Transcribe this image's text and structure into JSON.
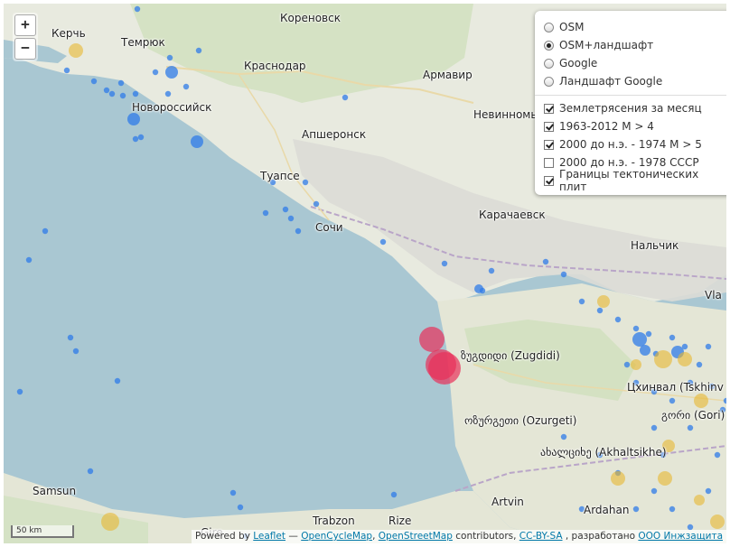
{
  "map": {
    "cities": [
      {
        "name": "Керчь"
      },
      {
        "name": "Темрюк"
      },
      {
        "name": "Кореновск"
      },
      {
        "name": "Краснодар"
      },
      {
        "name": "Армавир"
      },
      {
        "name": "Новороссийск"
      },
      {
        "name": "Невинномы"
      },
      {
        "name": "Апшеронск"
      },
      {
        "name": "Туапсе"
      },
      {
        "name": "Сочи"
      },
      {
        "name": "Карачаевск"
      },
      {
        "name": "Нальчик"
      },
      {
        "name": "Vla"
      },
      {
        "name": "ზუგდიდი (Zugdidi)"
      },
      {
        "name": "Цхинвал (Tskhinv"
      },
      {
        "name": "გორი (Gori)"
      },
      {
        "name": "ოზურგეთი (Ozurgeti)"
      },
      {
        "name": "ახალციხე (Akhaltsikhe)"
      },
      {
        "name": "Samsun"
      },
      {
        "name": "Artvin"
      },
      {
        "name": "Ardahan"
      },
      {
        "name": "Trabzon"
      },
      {
        "name": "Rize"
      },
      {
        "name": "Gire"
      }
    ],
    "colors": {
      "sea": "#a9c7d2",
      "land": "#e6e8dc",
      "recent_quake": "#e8315a",
      "quake_1963": "#2f7be8",
      "quake_historic": "#e8b830"
    }
  },
  "controls": {
    "zoom_in": "+",
    "zoom_out": "−"
  },
  "layers": {
    "base": [
      {
        "label": "OSM",
        "selected": false
      },
      {
        "label": "OSM+ландшафт",
        "selected": true
      },
      {
        "label": "Google",
        "selected": false
      },
      {
        "label": "Ландшафт Google",
        "selected": false
      }
    ],
    "overlays": [
      {
        "label": "Землетрясения за месяц",
        "checked": true
      },
      {
        "label": "1963-2012 M > 4",
        "checked": true
      },
      {
        "label": "2000 до н.э. - 1974 M > 5",
        "checked": true
      },
      {
        "label": "2000 до н.э. - 1978 СССР",
        "checked": false
      },
      {
        "label": "Границы тектонических плит",
        "checked": true
      }
    ]
  },
  "scale": {
    "label": "50 km"
  },
  "attribution": {
    "powered": "Powered by",
    "leaflet": "Leaflet",
    "dash": "—",
    "ocm": "OpenCycleMap",
    "comma": ",",
    "osm": "OpenStreetMap",
    "contrib": "contributors,",
    "license": "CC-BY-SA",
    "made": ", разработано",
    "company": "ООО Инжзащита"
  }
}
